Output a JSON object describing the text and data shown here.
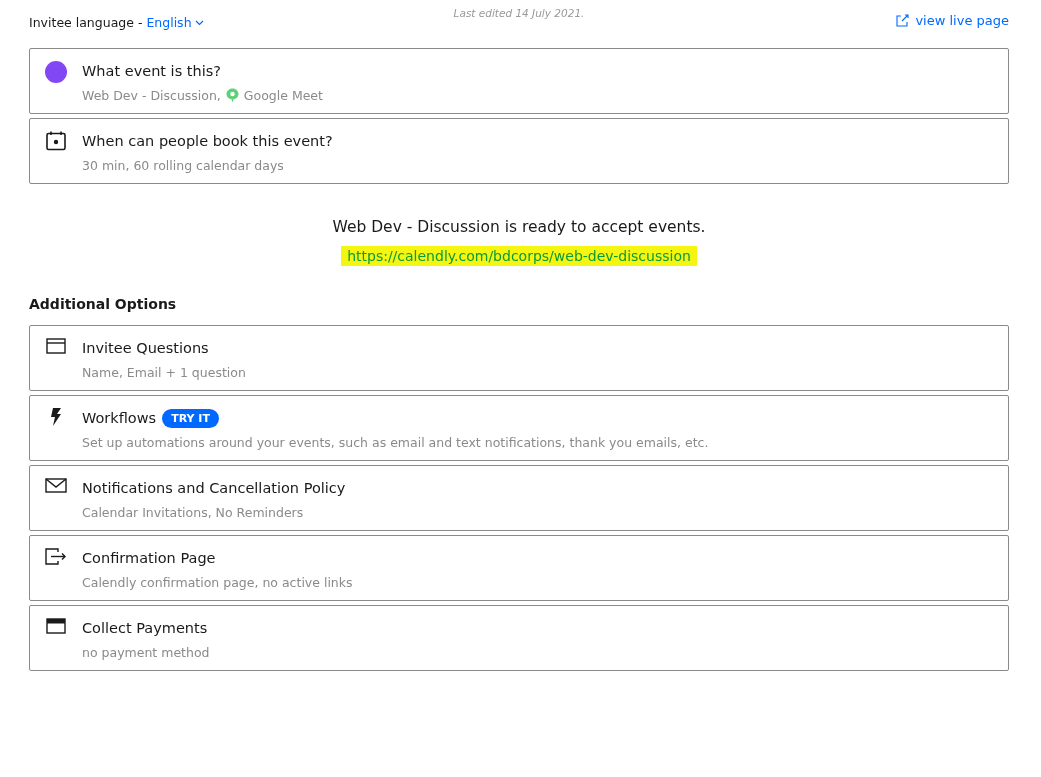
{
  "header": {
    "language_label": "Invitee language -",
    "language_value": "English",
    "last_edited": "Last edited 14 July 2021.",
    "live_link": "view live page"
  },
  "event_cards": [
    {
      "kind": "event",
      "color": "#8247f5",
      "title": "What event is this?",
      "subtitle": "Web Dev - Discussion,",
      "location": "Google Meet"
    },
    {
      "kind": "schedule",
      "title": "When can people book this event?",
      "subtitle": "30 min, 60 rolling calendar days"
    }
  ],
  "ready": {
    "message": "Web Dev - Discussion is ready to accept events.",
    "url": "https://calendly.com/bdcorps/web-dev-discussion",
    "highlighted": true
  },
  "options_heading": "Additional Options",
  "options": [
    {
      "kind": "questions",
      "title": "Invitee Questions",
      "subtitle": "Name, Email + 1 question"
    },
    {
      "kind": "workflows",
      "title": "Workflows",
      "badge": "TRY IT",
      "subtitle": "Set up automations around your events, such as email and text notifications, thank you emails, etc."
    },
    {
      "kind": "notifications",
      "title": "Notifications and Cancellation Policy",
      "subtitle": "Calendar Invitations, No Reminders"
    },
    {
      "kind": "confirmation",
      "title": "Confirmation Page",
      "subtitle": "Calendly confirmation page, no active links"
    },
    {
      "kind": "payments",
      "title": "Collect Payments",
      "subtitle": "no payment method"
    }
  ]
}
